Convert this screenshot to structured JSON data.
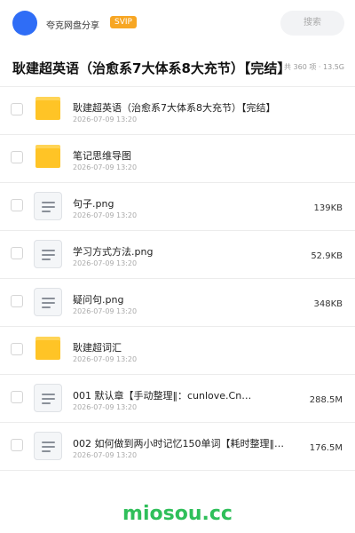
{
  "header": {
    "username": "夸克网盘分享",
    "vip_badge": "SVIP",
    "search_label": "搜索"
  },
  "folder": {
    "title": "耿建超英语（治愈系7大体系8大充节）【完结】",
    "meta": "共 360 项 · 13.5G"
  },
  "files": [
    {
      "name": "耿建超英语（治愈系7大体系8大充节）【完结】",
      "date": "2026-07-09 13:20",
      "size": "",
      "icon": "folder-icon"
    },
    {
      "name": "笔记思维导图",
      "date": "2026-07-09 13:20",
      "size": "",
      "icon": "folder-icon"
    },
    {
      "name": "句子.png",
      "date": "2026-07-09 13:20",
      "size": "139KB",
      "icon": "document-icon"
    },
    {
      "name": "学习方式方法.png",
      "date": "2026-07-09 13:20",
      "size": "52.9KB",
      "icon": "document-icon"
    },
    {
      "name": "疑问句.png",
      "date": "2026-07-09 13:20",
      "size": "348KB",
      "icon": "document-icon"
    },
    {
      "name": "耿建超词汇",
      "date": "2026-07-09 13:20",
      "size": "",
      "icon": "folder-icon"
    },
    {
      "name": "001 默认章【手动整理‖：cunlove.Cn…",
      "date": "2026-07-09 13:20",
      "size": "288.5M",
      "icon": "document-icon"
    },
    {
      "name": "002 如何做到两小时记忆150单词【耗时整理‖…",
      "date": "2026-07-09 13:20",
      "size": "176.5M",
      "icon": "document-icon"
    }
  ],
  "watermark": "miosou.cc",
  "colors": {
    "accent": "#2f6df6",
    "vip": "#f7a623",
    "folder": "#ffc426",
    "watermark": "#2fbf5a"
  }
}
